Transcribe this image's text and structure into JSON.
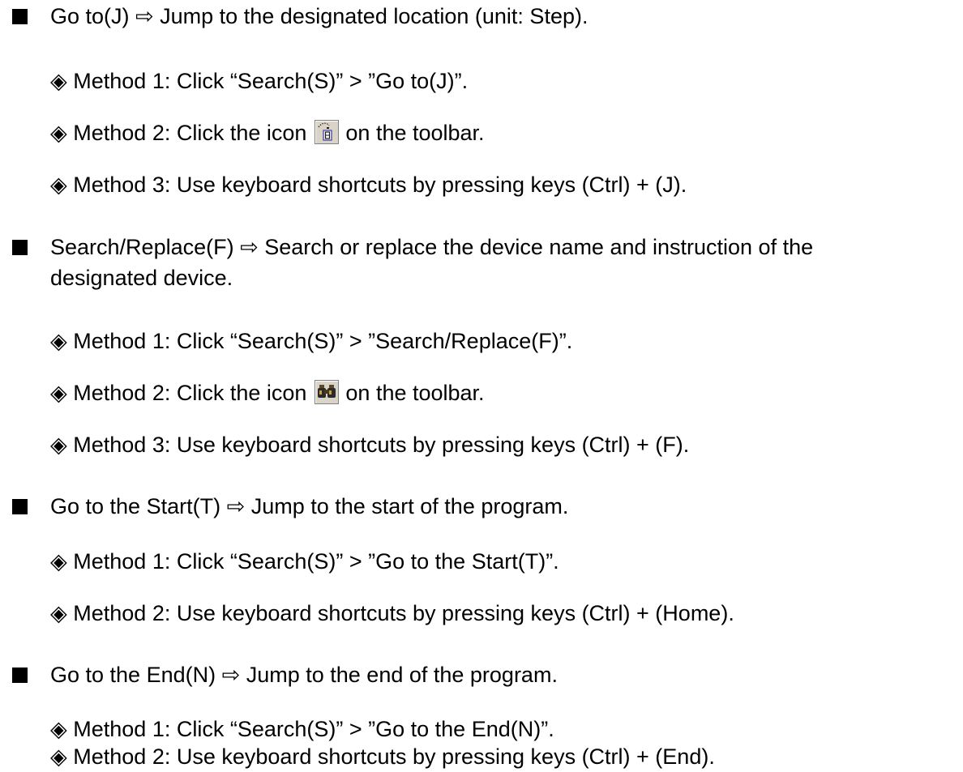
{
  "sections": [
    {
      "title": "Go to(J) ⇨ Jump to the designated location (unit: Step).",
      "methods": [
        "◈ Method 1: Click “Search(S)” > ”Go to(J)”.",
        {
          "before": "◈ Method 2: Click the icon",
          "icon": "go-to-icon",
          "after": "on the toolbar."
        },
        "◈ Method 3: Use keyboard shortcuts by pressing keys (Ctrl) + (J)."
      ]
    },
    {
      "title_line1": "Search/Replace(F) ⇨ Search or replace the device name and instruction of the",
      "title_line2": "designated device.",
      "methods": [
        "◈ Method 1: Click “Search(S)” > ”Search/Replace(F)”.",
        {
          "before": "◈ Method 2: Click the icon",
          "icon": "binoculars-icon",
          "after": "on the toolbar."
        },
        "◈ Method 3: Use keyboard shortcuts by pressing keys (Ctrl) + (F)."
      ]
    },
    {
      "title": "Go to the Start(T) ⇨ Jump to the start of the program.",
      "methods": [
        "◈ Method 1: Click “Search(S)” > ”Go to the Start(T)”.",
        "◈ Method 2: Use keyboard shortcuts by pressing keys (Ctrl) + (Home)."
      ]
    },
    {
      "title": "Go to the End(N) ⇨ Jump to the end of the program.",
      "methods": [
        "◈ Method 1: Click “Search(S)” > ”Go to the End(N)”.",
        "◈ Method 2: Use keyboard shortcuts by pressing keys (Ctrl) + (End)."
      ]
    }
  ]
}
